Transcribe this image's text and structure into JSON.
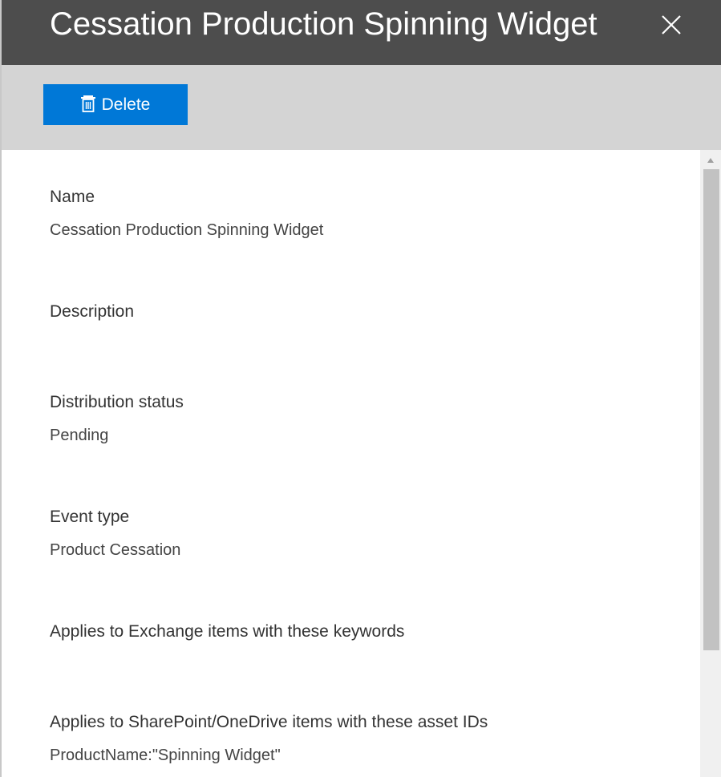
{
  "header": {
    "title": "Cessation Production Spinning Widget",
    "close_icon": "close-icon"
  },
  "toolbar": {
    "delete_label": "Delete",
    "delete_icon": "trash-icon",
    "button_color": "#0078d7"
  },
  "fields": [
    {
      "label": "Name",
      "value": "Cessation Production Spinning Widget"
    },
    {
      "label": "Description",
      "value": ""
    },
    {
      "label": "Distribution status",
      "value": "Pending"
    },
    {
      "label": "Event type",
      "value": "Product Cessation"
    },
    {
      "label": "Applies to Exchange items with these keywords",
      "value": ""
    },
    {
      "label": "Applies to SharePoint/OneDrive items with these asset IDs",
      "value": "ProductName:\"Spinning Widget\""
    }
  ],
  "colors": {
    "header_bg": "#4d4d4d",
    "toolbar_bg": "#d4d4d4"
  }
}
